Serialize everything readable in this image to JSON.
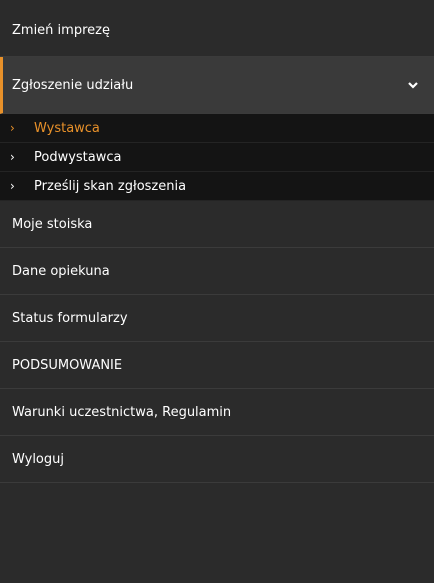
{
  "menu": {
    "top": "Zmień imprezę",
    "expanded": "Zgłoszenie udziału",
    "submenu": [
      "Wystawca",
      "Podwystawca",
      "Prześlij skan zgłoszenia"
    ],
    "items": [
      "Moje stoiska",
      "Dane opiekuna",
      "Status formularzy",
      "PODSUMOWANIE",
      "Warunki uczestnictwa, Regulamin",
      "Wyloguj"
    ]
  },
  "colors": {
    "accent": "#e8912a",
    "background": "#2b2b2b",
    "submenu_background": "#141414"
  },
  "icons": {
    "expand": "chevron-down-icon",
    "submenu_bullet": "chevron-right-icon"
  }
}
